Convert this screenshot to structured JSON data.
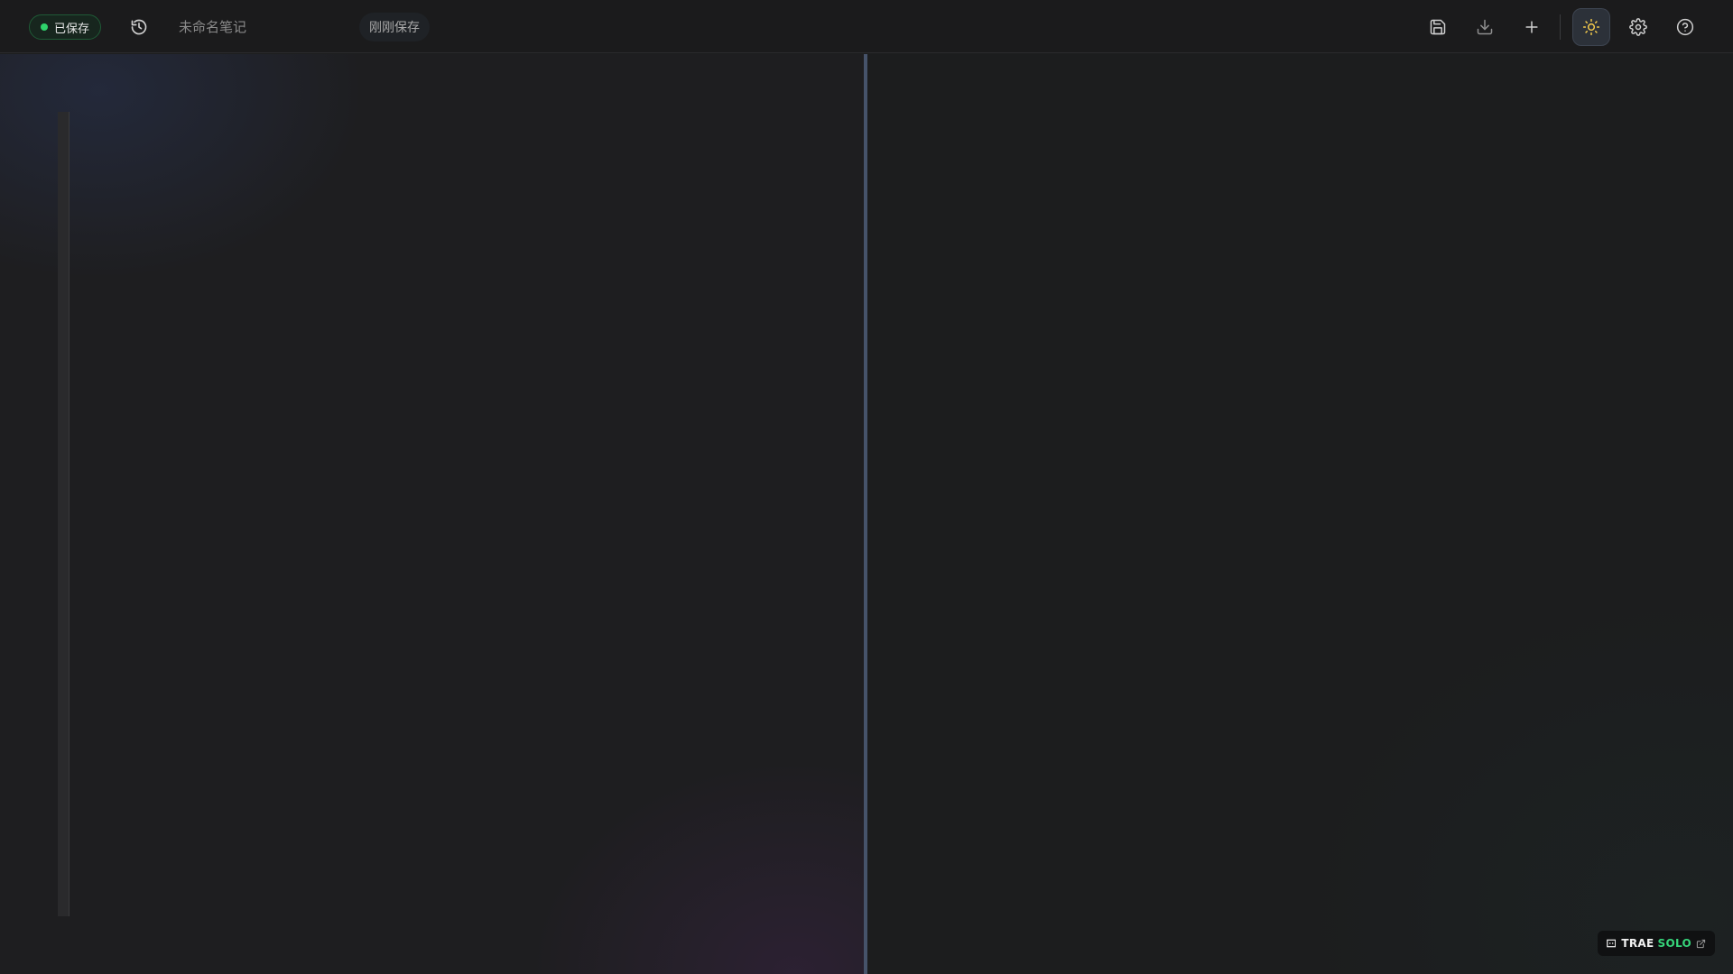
{
  "header": {
    "status_badge": "已保存",
    "title_placeholder": "未命名笔记",
    "save_time": "刚刚保存"
  },
  "icons": {
    "history": "history-icon",
    "save": "save-icon",
    "download": "download-icon",
    "new": "plus-icon",
    "theme": "sun-icon",
    "settings": "gear-icon",
    "help": "help-circle-icon",
    "trae_logo": "trae-logo-icon",
    "external": "external-link-icon"
  },
  "colors": {
    "status_green": "#2fd36b",
    "theme_icon_yellow": "#f2c94c",
    "solo_green": "#36d47a",
    "splitter": "#46536a"
  },
  "badge": {
    "brand": "TRAE",
    "suffix": "SOLO"
  }
}
